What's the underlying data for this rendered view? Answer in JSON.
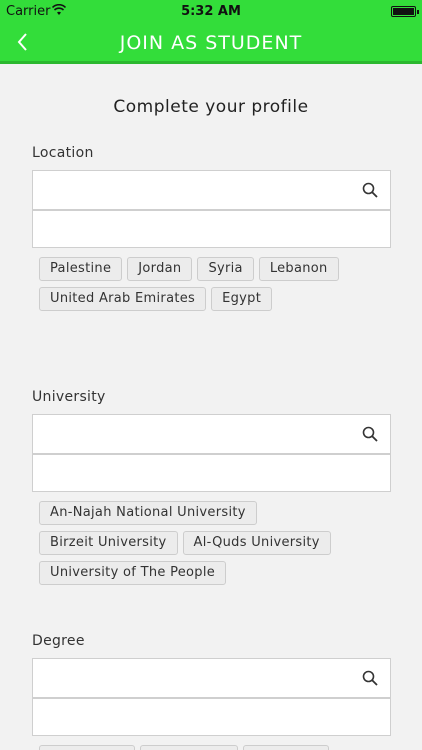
{
  "status_bar": {
    "carrier": "Carrier",
    "time": "5:32 AM"
  },
  "nav": {
    "title": "JOIN AS STUDENT",
    "back_icon": "chevron-left-icon"
  },
  "page_title": "Complete your profile",
  "location": {
    "label": "Location",
    "chips": [
      "Palestine",
      "Jordan",
      "Syria",
      "Lebanon",
      "United Arab Emirates",
      "Egypt"
    ]
  },
  "university": {
    "label": "University",
    "chips": [
      "An-Najah National University",
      "Birzeit University",
      "Al-Quds University",
      "University of The People"
    ]
  },
  "degree": {
    "label": "Degree"
  },
  "colors": {
    "accent": "#33dd3a",
    "background": "#f2f2f2"
  }
}
